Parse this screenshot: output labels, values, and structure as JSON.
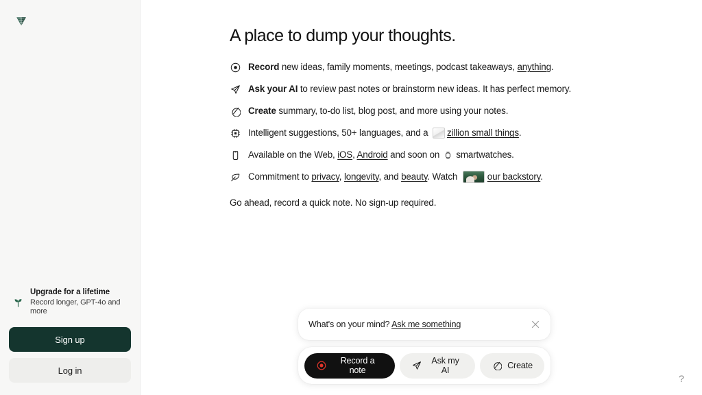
{
  "brand": {
    "logo_icon": "leaf-logo-icon",
    "accent_green": "#14352e",
    "record_red": "#e1342a"
  },
  "sidebar": {
    "upgrade": {
      "icon": "sprout-icon",
      "title": "Upgrade for a lifetime",
      "subtitle": "Record longer, GPT-4o and more"
    },
    "signup_label": "Sign up",
    "login_label": "Log in"
  },
  "main": {
    "title": "A place to dump your thoughts.",
    "features": [
      {
        "icon": "record-circle-icon",
        "lead": "Record",
        "rest_before_link": " new ideas, family moments, meetings, podcast takeaways, ",
        "link": "anything",
        "rest_after_link": "."
      },
      {
        "icon": "paper-plane-icon",
        "lead": "Ask your AI",
        "rest_before_link": " to review past notes or brainstorm new ideas. It has perfect memory.",
        "link": "",
        "rest_after_link": ""
      },
      {
        "icon": "create-slash-circle-icon",
        "lead": "Create",
        "rest_before_link": " summary, to-do list, blog post, and more using your notes.",
        "link": "",
        "rest_after_link": ""
      },
      {
        "icon": "chip-icon",
        "lead": "",
        "rest_before_link": "Intelligent suggestions, 50+ languages, and a ",
        "link": "zillion small things",
        "rest_after_link": "."
      },
      {
        "icon": "phone-icon",
        "lead": "",
        "rest_before_link": "Available on the Web, ",
        "link": "",
        "rest_after_link": ""
      },
      {
        "icon": "leaf-icon",
        "lead": "",
        "rest_before_link": "Commitment to ",
        "link": "",
        "rest_after_link": ""
      }
    ],
    "platform_line": {
      "prefix": "Available on the Web, ",
      "link_ios": "iOS",
      "comma": ", ",
      "link_android": "Android",
      "middle": " and soon on ",
      "watch_icon": "smartwatch-icon",
      "suffix": " smartwatches."
    },
    "commitment_line": {
      "prefix": "Commitment to ",
      "link_privacy": "privacy",
      "sep1": ", ",
      "link_longevity": "longevity",
      "sep2": ", and ",
      "link_beauty": "beauty",
      "middle": ". Watch ",
      "thumb": "backstory-video-thumbnail",
      "link_backstory": "our backstory",
      "suffix": "."
    },
    "closing_line": "Go ahead, record a quick note. No sign-up required."
  },
  "composer": {
    "prompt_prefix": "What's on your mind? ",
    "prompt_cta": "Ask me something",
    "close_icon": "close-icon",
    "actions": [
      {
        "icon": "record-circle-icon",
        "label": "Record a note",
        "style": "primary"
      },
      {
        "icon": "paper-plane-icon",
        "label": "Ask my AI",
        "style": "secondary"
      },
      {
        "icon": "create-slash-circle-icon",
        "label": "Create",
        "style": "secondary"
      }
    ]
  },
  "help": {
    "label": "?"
  }
}
